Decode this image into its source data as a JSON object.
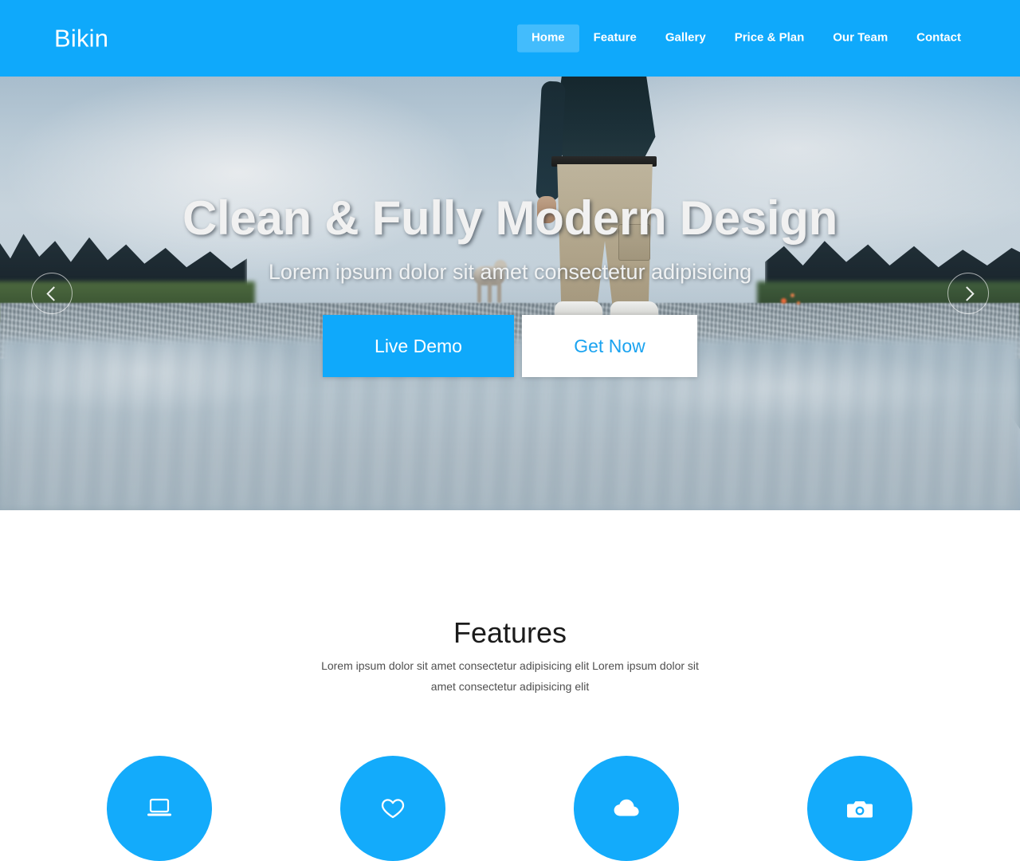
{
  "header": {
    "brand": "Bikin",
    "nav": [
      {
        "label": "Home",
        "name": "nav-item-home",
        "active": true
      },
      {
        "label": "Feature",
        "name": "nav-item-feature",
        "active": false
      },
      {
        "label": "Gallery",
        "name": "nav-item-gallery",
        "active": false
      },
      {
        "label": "Price & Plan",
        "name": "nav-item-price-plan",
        "active": false
      },
      {
        "label": "Our Team",
        "name": "nav-item-our-team",
        "active": false
      },
      {
        "label": "Contact",
        "name": "nav-item-contact",
        "active": false
      }
    ]
  },
  "hero": {
    "title": "Clean & Fully Modern Design",
    "subtitle": "Lorem ipsum dolor sit amet consectetur adipisicing",
    "primary_button": "Live Demo",
    "secondary_button": "Get Now",
    "prev_icon": "chevron-left-icon",
    "next_icon": "chevron-right-icon"
  },
  "features": {
    "title": "Features",
    "description": "Lorem ipsum dolor sit amet consectetur adipisicing elit Lorem ipsum dolor sit amet consectetur adipisicing elit",
    "cards": [
      {
        "icon": "laptop-icon",
        "name": "feature-card-laptop"
      },
      {
        "icon": "heart-icon",
        "name": "feature-card-heart"
      },
      {
        "icon": "cloud-icon",
        "name": "feature-card-cloud"
      },
      {
        "icon": "camera-icon",
        "name": "feature-card-camera"
      }
    ]
  },
  "colors": {
    "brand_blue": "#0fa9fb",
    "icon_circle_blue": "#13abfb",
    "button_text_blue": "#1aa3f0",
    "heading_dark": "#1b1b1b",
    "body_text": "#4f4f4f",
    "page_background": "#ffffff"
  }
}
